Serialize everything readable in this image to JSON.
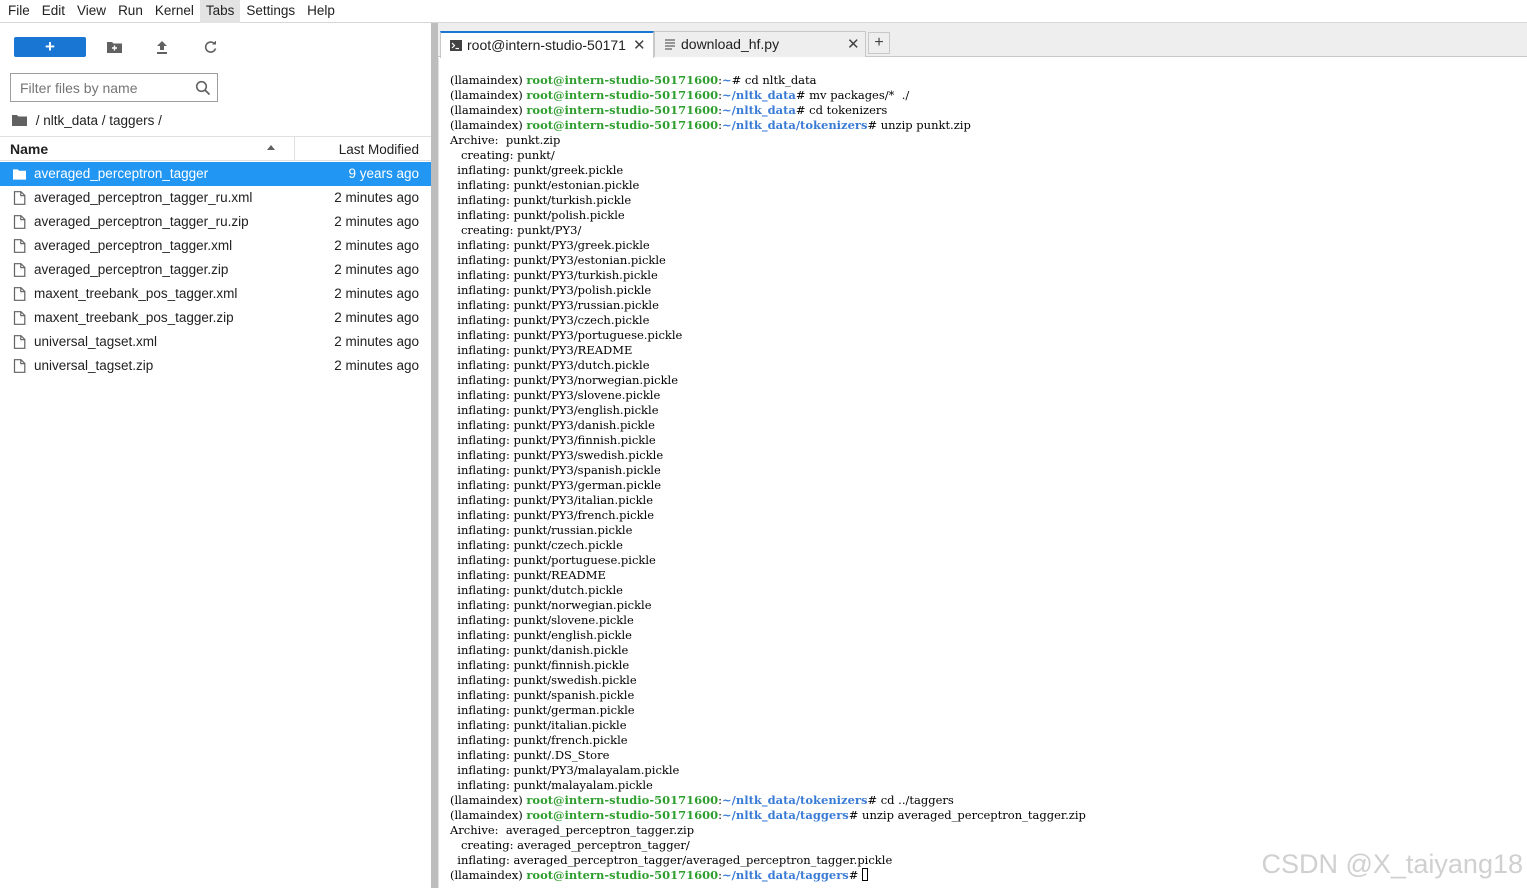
{
  "menu": [
    "File",
    "Edit",
    "View",
    "Run",
    "Kernel",
    "Tabs",
    "Settings",
    "Help"
  ],
  "menu_active_index": 5,
  "toolbar": {
    "new_label": "+",
    "icons": [
      "new-folder-icon",
      "upload-icon",
      "refresh-icon"
    ]
  },
  "filter": {
    "placeholder": "Filter files by name"
  },
  "breadcrumb": {
    "path": " / nltk_data / taggers / "
  },
  "listing": {
    "header_name": "Name",
    "header_modified": "Last Modified",
    "rows": [
      {
        "name": "averaged_perceptron_tagger",
        "modified": "9 years ago",
        "type": "folder",
        "selected": true
      },
      {
        "name": "averaged_perceptron_tagger_ru.xml",
        "modified": "2 minutes ago",
        "type": "file",
        "selected": false
      },
      {
        "name": "averaged_perceptron_tagger_ru.zip",
        "modified": "2 minutes ago",
        "type": "file",
        "selected": false
      },
      {
        "name": "averaged_perceptron_tagger.xml",
        "modified": "2 minutes ago",
        "type": "file",
        "selected": false
      },
      {
        "name": "averaged_perceptron_tagger.zip",
        "modified": "2 minutes ago",
        "type": "file",
        "selected": false
      },
      {
        "name": "maxent_treebank_pos_tagger.xml",
        "modified": "2 minutes ago",
        "type": "file",
        "selected": false
      },
      {
        "name": "maxent_treebank_pos_tagger.zip",
        "modified": "2 minutes ago",
        "type": "file",
        "selected": false
      },
      {
        "name": "universal_tagset.xml",
        "modified": "2 minutes ago",
        "type": "file",
        "selected": false
      },
      {
        "name": "universal_tagset.zip",
        "modified": "2 minutes ago",
        "type": "file",
        "selected": false
      }
    ]
  },
  "tabs": [
    {
      "label": "root@intern-studio-50171",
      "icon": "terminal-icon",
      "close": "✕",
      "active": true
    },
    {
      "label": "download_hf.py",
      "icon": "text-file-icon",
      "close": "✕",
      "active": false
    }
  ],
  "add_tab_label": "+",
  "terminal": {
    "env": "(llamaindex)",
    "user_host": "root@intern-studio-50171600",
    "lines": [
      {
        "kind": "prompt",
        "path": "~",
        "cmd": "# cd nltk_data"
      },
      {
        "kind": "prompt",
        "path": "~/nltk_data",
        "cmd": "# mv packages/*  ./"
      },
      {
        "kind": "prompt",
        "path": "~/nltk_data",
        "cmd": "# cd tokenizers"
      },
      {
        "kind": "prompt",
        "path": "~/nltk_data/tokenizers",
        "cmd": "# unzip punkt.zip"
      },
      {
        "kind": "text",
        "text": "Archive:  punkt.zip"
      },
      {
        "kind": "text",
        "text": "   creating: punkt/"
      },
      {
        "kind": "text",
        "text": "  inflating: punkt/greek.pickle"
      },
      {
        "kind": "text",
        "text": "  inflating: punkt/estonian.pickle"
      },
      {
        "kind": "text",
        "text": "  inflating: punkt/turkish.pickle"
      },
      {
        "kind": "text",
        "text": "  inflating: punkt/polish.pickle"
      },
      {
        "kind": "text",
        "text": "   creating: punkt/PY3/"
      },
      {
        "kind": "text",
        "text": "  inflating: punkt/PY3/greek.pickle"
      },
      {
        "kind": "text",
        "text": "  inflating: punkt/PY3/estonian.pickle"
      },
      {
        "kind": "text",
        "text": "  inflating: punkt/PY3/turkish.pickle"
      },
      {
        "kind": "text",
        "text": "  inflating: punkt/PY3/polish.pickle"
      },
      {
        "kind": "text",
        "text": "  inflating: punkt/PY3/russian.pickle"
      },
      {
        "kind": "text",
        "text": "  inflating: punkt/PY3/czech.pickle"
      },
      {
        "kind": "text",
        "text": "  inflating: punkt/PY3/portuguese.pickle"
      },
      {
        "kind": "text",
        "text": "  inflating: punkt/PY3/README"
      },
      {
        "kind": "text",
        "text": "  inflating: punkt/PY3/dutch.pickle"
      },
      {
        "kind": "text",
        "text": "  inflating: punkt/PY3/norwegian.pickle"
      },
      {
        "kind": "text",
        "text": "  inflating: punkt/PY3/slovene.pickle"
      },
      {
        "kind": "text",
        "text": "  inflating: punkt/PY3/english.pickle"
      },
      {
        "kind": "text",
        "text": "  inflating: punkt/PY3/danish.pickle"
      },
      {
        "kind": "text",
        "text": "  inflating: punkt/PY3/finnish.pickle"
      },
      {
        "kind": "text",
        "text": "  inflating: punkt/PY3/swedish.pickle"
      },
      {
        "kind": "text",
        "text": "  inflating: punkt/PY3/spanish.pickle"
      },
      {
        "kind": "text",
        "text": "  inflating: punkt/PY3/german.pickle"
      },
      {
        "kind": "text",
        "text": "  inflating: punkt/PY3/italian.pickle"
      },
      {
        "kind": "text",
        "text": "  inflating: punkt/PY3/french.pickle"
      },
      {
        "kind": "text",
        "text": "  inflating: punkt/russian.pickle"
      },
      {
        "kind": "text",
        "text": "  inflating: punkt/czech.pickle"
      },
      {
        "kind": "text",
        "text": "  inflating: punkt/portuguese.pickle"
      },
      {
        "kind": "text",
        "text": "  inflating: punkt/README"
      },
      {
        "kind": "text",
        "text": "  inflating: punkt/dutch.pickle"
      },
      {
        "kind": "text",
        "text": "  inflating: punkt/norwegian.pickle"
      },
      {
        "kind": "text",
        "text": "  inflating: punkt/slovene.pickle"
      },
      {
        "kind": "text",
        "text": "  inflating: punkt/english.pickle"
      },
      {
        "kind": "text",
        "text": "  inflating: punkt/danish.pickle"
      },
      {
        "kind": "text",
        "text": "  inflating: punkt/finnish.pickle"
      },
      {
        "kind": "text",
        "text": "  inflating: punkt/swedish.pickle"
      },
      {
        "kind": "text",
        "text": "  inflating: punkt/spanish.pickle"
      },
      {
        "kind": "text",
        "text": "  inflating: punkt/german.pickle"
      },
      {
        "kind": "text",
        "text": "  inflating: punkt/italian.pickle"
      },
      {
        "kind": "text",
        "text": "  inflating: punkt/french.pickle"
      },
      {
        "kind": "text",
        "text": "  inflating: punkt/.DS_Store"
      },
      {
        "kind": "text",
        "text": "  inflating: punkt/PY3/malayalam.pickle"
      },
      {
        "kind": "text",
        "text": "  inflating: punkt/malayalam.pickle"
      },
      {
        "kind": "prompt",
        "path": "~/nltk_data/tokenizers",
        "cmd": "# cd ../taggers"
      },
      {
        "kind": "prompt",
        "path": "~/nltk_data/taggers",
        "cmd": "# unzip averaged_perceptron_tagger.zip"
      },
      {
        "kind": "text",
        "text": "Archive:  averaged_perceptron_tagger.zip"
      },
      {
        "kind": "text",
        "text": "   creating: averaged_perceptron_tagger/"
      },
      {
        "kind": "text",
        "text": "  inflating: averaged_perceptron_tagger/averaged_perceptron_tagger.pickle"
      },
      {
        "kind": "prompt",
        "path": "~/nltk_data/taggers",
        "cmd": "# ",
        "cursor": true
      }
    ]
  },
  "watermark": "CSDN @X_taiyang18",
  "colors": {
    "accent": "#1976d2",
    "selection": "#2196f3",
    "prompt_user": "#2e9f2e",
    "prompt_path": "#3a7bd5"
  }
}
